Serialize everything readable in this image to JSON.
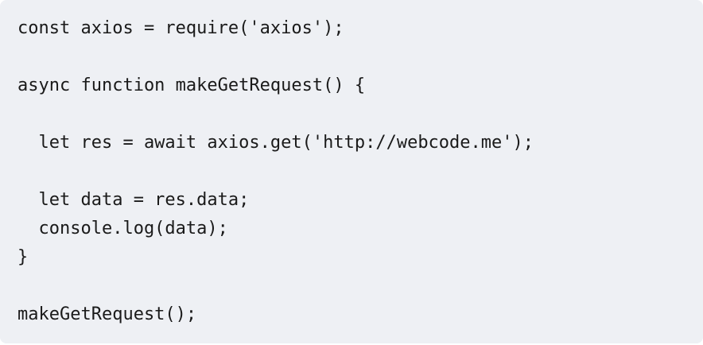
{
  "code": {
    "lines": [
      "const axios = require('axios');",
      "",
      "async function makeGetRequest() {",
      "",
      "  let res = await axios.get('http://webcode.me');",
      "",
      "  let data = res.data;",
      "  console.log(data);",
      "}",
      "",
      "makeGetRequest();"
    ]
  },
  "colors": {
    "background": "#eef0f4",
    "text": "#1a1a1a"
  }
}
